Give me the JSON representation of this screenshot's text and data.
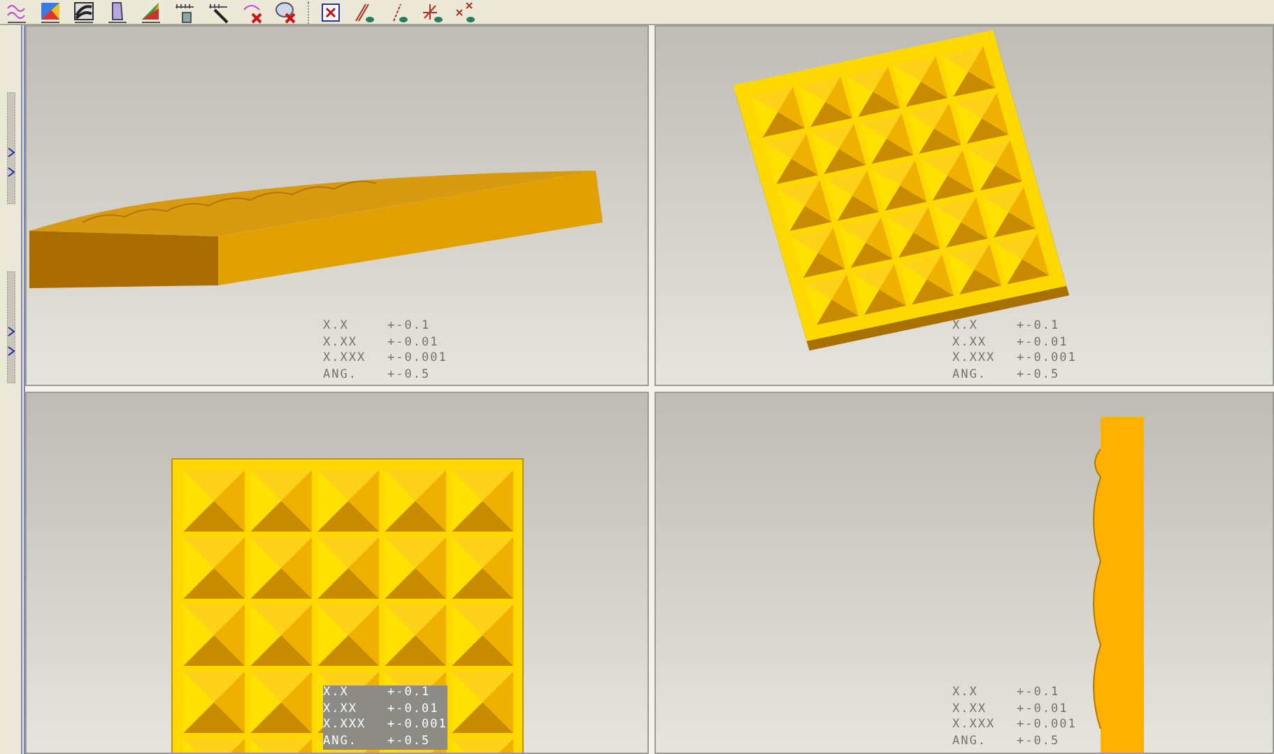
{
  "viewports": [
    {
      "kind": "side",
      "note_highlighted": false,
      "tolerances": [
        {
          "label": "X.X",
          "value": "+-0.1"
        },
        {
          "label": "X.XX",
          "value": "+-0.01"
        },
        {
          "label": "X.XXX",
          "value": "+-0.001"
        },
        {
          "label": "ANG.",
          "value": "+-0.5"
        }
      ]
    },
    {
      "kind": "iso",
      "note_highlighted": false,
      "tolerances": [
        {
          "label": "X.X",
          "value": "+-0.1"
        },
        {
          "label": "X.XX",
          "value": "+-0.01"
        },
        {
          "label": "X.XXX",
          "value": "+-0.001"
        },
        {
          "label": "ANG.",
          "value": "+-0.5"
        }
      ]
    },
    {
      "kind": "front",
      "note_highlighted": true,
      "tolerances": [
        {
          "label": "X.X",
          "value": "+-0.1"
        },
        {
          "label": "X.XX",
          "value": "+-0.01"
        },
        {
          "label": "X.XXX",
          "value": "+-0.001"
        },
        {
          "label": "ANG.",
          "value": "+-0.5"
        }
      ]
    },
    {
      "kind": "edge",
      "note_highlighted": false,
      "tolerances": [
        {
          "label": "X.X",
          "value": "+-0.1"
        },
        {
          "label": "X.XX",
          "value": "+-0.01"
        },
        {
          "label": "X.XXX",
          "value": "+-0.001"
        },
        {
          "label": "ANG.",
          "value": "+-0.5"
        }
      ]
    }
  ]
}
